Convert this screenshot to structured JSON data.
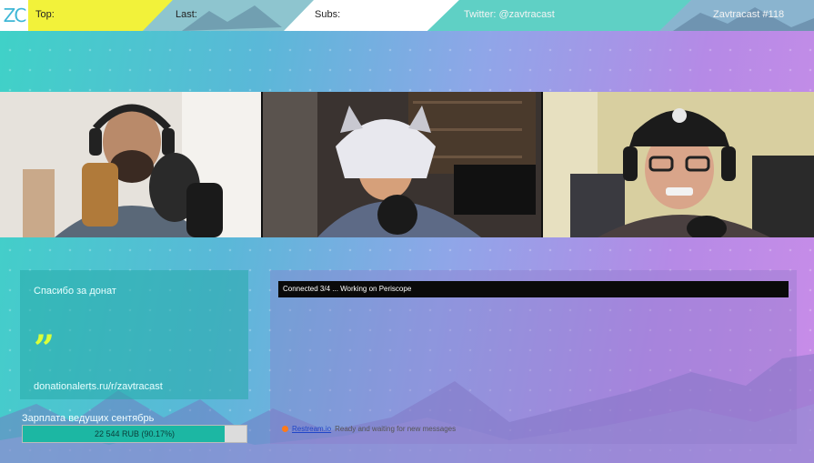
{
  "topbar": {
    "logo": "ZC",
    "top_label": "Top:",
    "last_label": "Last:",
    "subs_label": "Subs:",
    "twitter": "Twitter: @zavtracast",
    "episode": "Zavtracast #118"
  },
  "donation_panel": {
    "title": "Спасибо за донат",
    "quote": "”",
    "link": "donationalerts.ru/r/zavtracast"
  },
  "goal": {
    "label": "Зарплата ведущих сентябрь",
    "progress_text": "22 544 RUB (90.17%)",
    "progress_fraction": 0.9017
  },
  "chat_panel": {
    "status": "Connected 3/4 ... Working on Periscope",
    "source_link": "Restream.io",
    "message": "Ready and waiting for new messages"
  },
  "colors": {
    "yellow": "#f2f23a",
    "teal": "#1cb7a3",
    "accent_lime": "#d9ff3a"
  }
}
